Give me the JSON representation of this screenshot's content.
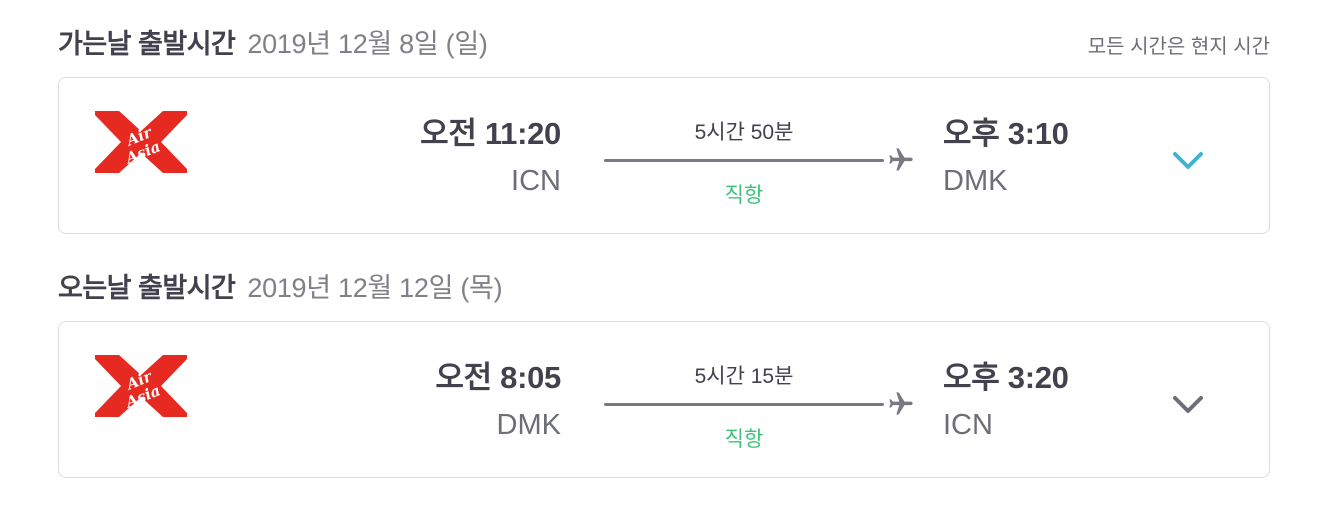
{
  "outbound": {
    "title": "가는날 출발시간",
    "date": "2019년 12월 8일 (일)",
    "timezone_note": "모든 시간은 현지 시간",
    "flight": {
      "airline_logo": "AirAsia",
      "departure_time": "오전 11:20",
      "departure_airport": "ICN",
      "duration": "5시간 50분",
      "stops": "직항",
      "arrival_time": "오후 3:10",
      "arrival_airport": "DMK",
      "chevron_color": "#3fb3cf"
    }
  },
  "inbound": {
    "title": "오는날 출발시간",
    "date": "2019년 12월 12일 (목)",
    "flight": {
      "airline_logo": "AirAsia",
      "departure_time": "오전 8:05",
      "departure_airport": "DMK",
      "duration": "5시간 15분",
      "stops": "직항",
      "arrival_time": "오후 3:20",
      "arrival_airport": "ICN",
      "chevron_color": "#6e6e78"
    }
  },
  "icons": {
    "plane": "plane-icon",
    "expand": "chevron-down-icon"
  },
  "colors": {
    "brand_red": "#e62a22",
    "direct_green": "#3ec27a"
  }
}
